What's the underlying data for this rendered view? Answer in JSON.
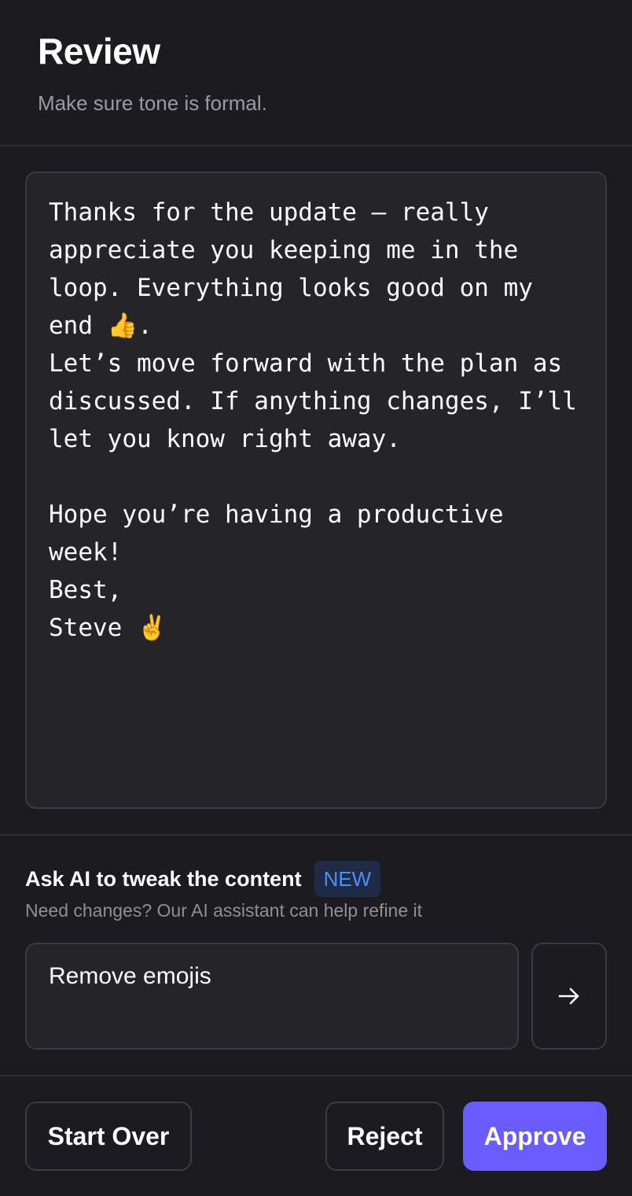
{
  "header": {
    "title": "Review",
    "subtitle": "Make sure tone is formal."
  },
  "editor": {
    "content": "Thanks for the update — really appreciate you keeping me in the loop. Everything looks good on my end 👍.\nLet’s move forward with the plan as discussed. If anything changes, I’ll let you know right away.\n\nHope you’re having a productive week!\nBest,\nSteve ✌️"
  },
  "ai": {
    "title": "Ask AI to tweak the content",
    "badge": "NEW",
    "description": "Need changes? Our AI assistant can help refine it",
    "input_value": "Remove emojis",
    "send_icon": "arrow-right-icon"
  },
  "actions": {
    "start_over_label": "Start Over",
    "reject_label": "Reject",
    "approve_label": "Approve"
  },
  "colors": {
    "background": "#1b1b20",
    "surface": "#242429",
    "border": "#3a3a42",
    "accent": "#6a5cff",
    "badge_text": "#4d8ff5",
    "badge_bg": "#1f2a44",
    "muted_text": "#9a9aa3"
  }
}
